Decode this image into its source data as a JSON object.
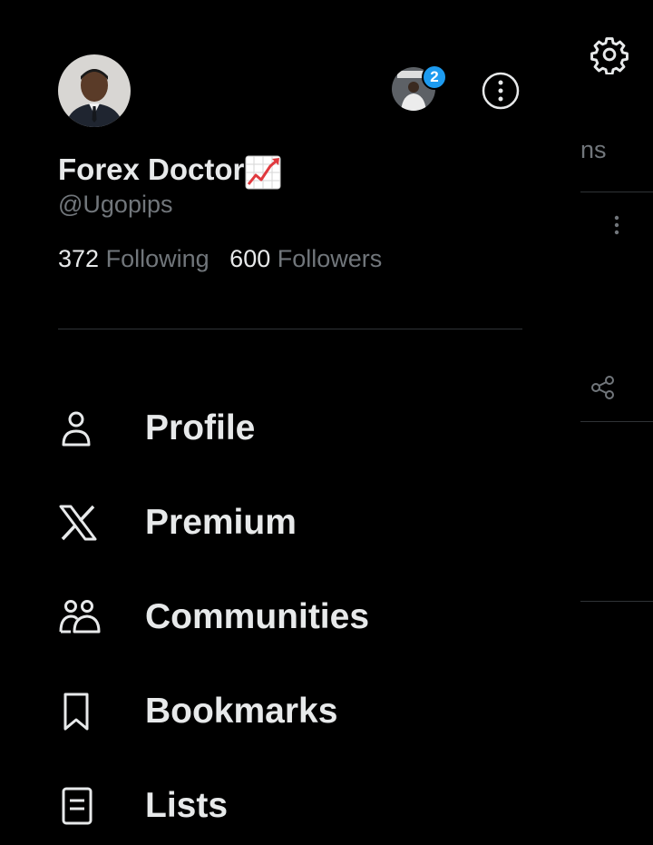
{
  "profile": {
    "display_name": "Forex Doctor",
    "name_emoji_icon": "chart-increasing-icon",
    "handle": "@Ugopips",
    "following_count": "372",
    "following_label": "Following",
    "followers_count": "600",
    "followers_label": "Followers"
  },
  "account_switcher": {
    "badge_count": "2"
  },
  "menu": [
    {
      "label": "Profile",
      "icon": "person-icon"
    },
    {
      "label": "Premium",
      "icon": "x-logo-icon"
    },
    {
      "label": "Communities",
      "icon": "communities-icon"
    },
    {
      "label": "Bookmarks",
      "icon": "bookmark-icon"
    },
    {
      "label": "Lists",
      "icon": "lists-icon"
    }
  ],
  "background": {
    "tab_fragment": "ns"
  },
  "colors": {
    "background": "#000000",
    "text_primary": "#e7e9ea",
    "text_secondary": "#71767b",
    "accent": "#1d9bf0",
    "divider": "#2f3336"
  }
}
